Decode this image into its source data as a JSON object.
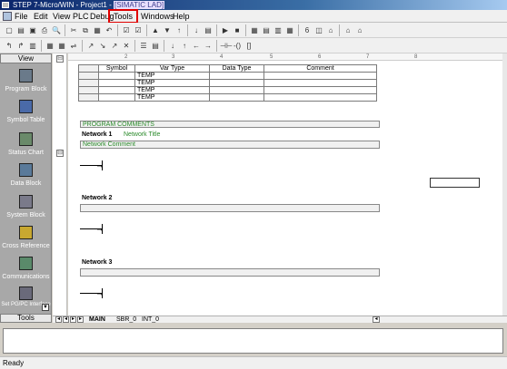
{
  "window": {
    "title": "STEP 7-Micro/WIN - Project1 - ",
    "title_highlight": "[SIMATIC LAD]"
  },
  "menu": {
    "items": [
      "File",
      "Edit",
      "View",
      "PLC",
      "Debug",
      "Tools",
      "Windows",
      "Help"
    ]
  },
  "toolbar1": {
    "icons": [
      "new-icon",
      "open-icon",
      "save-icon",
      "print-icon",
      "print-preview-icon",
      "cut-icon",
      "copy-icon",
      "paste-icon",
      "undo-icon",
      "compile-icon",
      "compile-all-icon",
      "upload-icon",
      "download-icon",
      "sort-asc-icon",
      "sort-desc-icon",
      "options-icon",
      "run-icon",
      "stop-icon",
      "program-status-icon",
      "trend-icon",
      "chart-status-icon",
      "single-read-icon",
      "force-icon",
      "unforce-icon",
      "unforce-all-icon",
      "read-all-forced-icon",
      "edit-mode-icon"
    ],
    "glyphs": [
      "▢",
      "▤",
      "▣",
      "⎙",
      "🔍",
      "✂",
      "⧉",
      "▦",
      "↶",
      "☑",
      "☑",
      "▲",
      "▼",
      "↑",
      "↓",
      "▤",
      "▶",
      "■",
      "▦",
      "▤",
      "▥",
      "▦",
      "6",
      "◫",
      "⌂",
      "⌂",
      "⌂"
    ]
  },
  "toolbar2": {
    "icons": [
      "stl-icon",
      "lad-icon",
      "fbd-icon",
      "toggle-comment-icon",
      "insert-network-icon",
      "delete-network-icon",
      "bookmark-icon",
      "next-bookmark-icon",
      "prev-bookmark-icon",
      "clear-bookmarks-icon",
      "symbol-table-icon",
      "apply-symbols-icon",
      "line-down-icon",
      "line-up-icon",
      "line-left-icon",
      "line-right-icon",
      "contact-icon",
      "coil-icon",
      "box-icon"
    ],
    "glyphs": [
      "↰",
      "↱",
      "▥",
      "▦",
      "▦",
      "⇌",
      "↗",
      "↘",
      "↗",
      "✕",
      "☰",
      "▤",
      "↓",
      "↑",
      "←",
      "→",
      "⊣⊢",
      "-()",
      "[]"
    ]
  },
  "nav": {
    "header": "View",
    "items": [
      {
        "label": "Program Block",
        "icon": "program-block-icon"
      },
      {
        "label": "Symbol Table",
        "icon": "symbol-table-icon"
      },
      {
        "label": "Status Chart",
        "icon": "status-chart-icon"
      },
      {
        "label": "Data Block",
        "icon": "data-block-icon"
      },
      {
        "label": "System Block",
        "icon": "system-block-icon"
      },
      {
        "label": "Cross Reference",
        "icon": "cross-reference-icon"
      },
      {
        "label": "Communications",
        "icon": "communications-icon"
      },
      {
        "label": "Set PG/PC Interface",
        "icon": "set-pg-pc-interface-icon"
      }
    ],
    "footer": "Tools"
  },
  "ruler": {
    "marks": [
      "2",
      "3",
      "4",
      "5",
      "6",
      "7",
      "8"
    ]
  },
  "var_table": {
    "headers": [
      "Symbol",
      "Var Type",
      "Data Type",
      "Comment"
    ],
    "rows": [
      {
        "symbol": "",
        "var_type": "TEMP",
        "data_type": "",
        "comment": ""
      },
      {
        "symbol": "",
        "var_type": "TEMP",
        "data_type": "",
        "comment": ""
      },
      {
        "symbol": "",
        "var_type": "TEMP",
        "data_type": "",
        "comment": ""
      },
      {
        "symbol": "",
        "var_type": "TEMP",
        "data_type": "",
        "comment": ""
      }
    ]
  },
  "program": {
    "program_comments": "PROGRAM COMMENTS",
    "networks": [
      {
        "title": "Network 1",
        "subtitle": "Network Title",
        "comment": "Network Comment"
      },
      {
        "title": "Network 2",
        "subtitle": "",
        "comment": ""
      },
      {
        "title": "Network 3",
        "subtitle": "",
        "comment": ""
      }
    ]
  },
  "tabs": {
    "items": [
      "MAIN",
      "SBR_0",
      "INT_0"
    ],
    "active": "MAIN"
  },
  "status": {
    "text": "Ready"
  },
  "colors": {
    "title_bar": "#0a246a",
    "highlight_box": "#e00000",
    "comment_green": "#2a8a2a",
    "nav_bg": "#a8a8a8"
  }
}
